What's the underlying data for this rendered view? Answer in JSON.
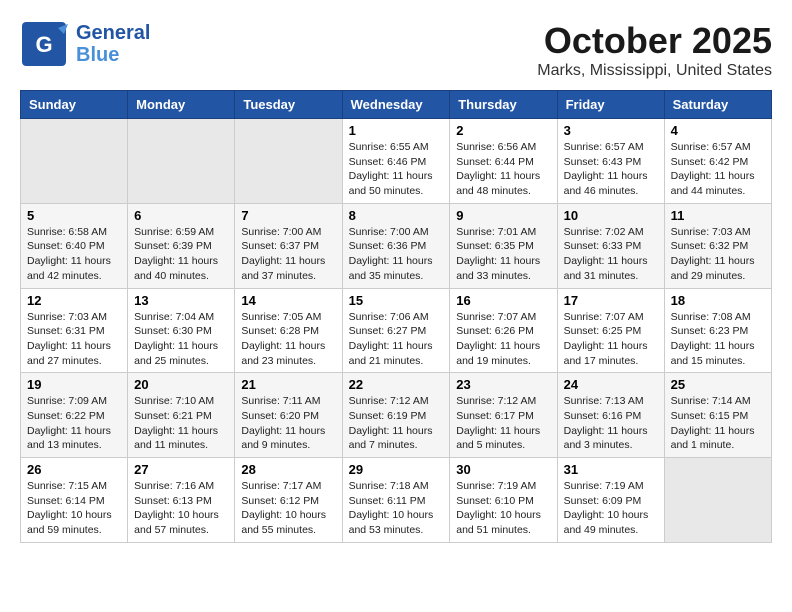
{
  "logo": {
    "general": "General",
    "blue": "Blue",
    "bird_symbol": "🐦"
  },
  "title": "October 2025",
  "location": "Marks, Mississippi, United States",
  "headers": [
    "Sunday",
    "Monday",
    "Tuesday",
    "Wednesday",
    "Thursday",
    "Friday",
    "Saturday"
  ],
  "weeks": [
    [
      {
        "day": "",
        "info": ""
      },
      {
        "day": "",
        "info": ""
      },
      {
        "day": "",
        "info": ""
      },
      {
        "day": "1",
        "info": "Sunrise: 6:55 AM\nSunset: 6:46 PM\nDaylight: 11 hours\nand 50 minutes."
      },
      {
        "day": "2",
        "info": "Sunrise: 6:56 AM\nSunset: 6:44 PM\nDaylight: 11 hours\nand 48 minutes."
      },
      {
        "day": "3",
        "info": "Sunrise: 6:57 AM\nSunset: 6:43 PM\nDaylight: 11 hours\nand 46 minutes."
      },
      {
        "day": "4",
        "info": "Sunrise: 6:57 AM\nSunset: 6:42 PM\nDaylight: 11 hours\nand 44 minutes."
      }
    ],
    [
      {
        "day": "5",
        "info": "Sunrise: 6:58 AM\nSunset: 6:40 PM\nDaylight: 11 hours\nand 42 minutes."
      },
      {
        "day": "6",
        "info": "Sunrise: 6:59 AM\nSunset: 6:39 PM\nDaylight: 11 hours\nand 40 minutes."
      },
      {
        "day": "7",
        "info": "Sunrise: 7:00 AM\nSunset: 6:37 PM\nDaylight: 11 hours\nand 37 minutes."
      },
      {
        "day": "8",
        "info": "Sunrise: 7:00 AM\nSunset: 6:36 PM\nDaylight: 11 hours\nand 35 minutes."
      },
      {
        "day": "9",
        "info": "Sunrise: 7:01 AM\nSunset: 6:35 PM\nDaylight: 11 hours\nand 33 minutes."
      },
      {
        "day": "10",
        "info": "Sunrise: 7:02 AM\nSunset: 6:33 PM\nDaylight: 11 hours\nand 31 minutes."
      },
      {
        "day": "11",
        "info": "Sunrise: 7:03 AM\nSunset: 6:32 PM\nDaylight: 11 hours\nand 29 minutes."
      }
    ],
    [
      {
        "day": "12",
        "info": "Sunrise: 7:03 AM\nSunset: 6:31 PM\nDaylight: 11 hours\nand 27 minutes."
      },
      {
        "day": "13",
        "info": "Sunrise: 7:04 AM\nSunset: 6:30 PM\nDaylight: 11 hours\nand 25 minutes."
      },
      {
        "day": "14",
        "info": "Sunrise: 7:05 AM\nSunset: 6:28 PM\nDaylight: 11 hours\nand 23 minutes."
      },
      {
        "day": "15",
        "info": "Sunrise: 7:06 AM\nSunset: 6:27 PM\nDaylight: 11 hours\nand 21 minutes."
      },
      {
        "day": "16",
        "info": "Sunrise: 7:07 AM\nSunset: 6:26 PM\nDaylight: 11 hours\nand 19 minutes."
      },
      {
        "day": "17",
        "info": "Sunrise: 7:07 AM\nSunset: 6:25 PM\nDaylight: 11 hours\nand 17 minutes."
      },
      {
        "day": "18",
        "info": "Sunrise: 7:08 AM\nSunset: 6:23 PM\nDaylight: 11 hours\nand 15 minutes."
      }
    ],
    [
      {
        "day": "19",
        "info": "Sunrise: 7:09 AM\nSunset: 6:22 PM\nDaylight: 11 hours\nand 13 minutes."
      },
      {
        "day": "20",
        "info": "Sunrise: 7:10 AM\nSunset: 6:21 PM\nDaylight: 11 hours\nand 11 minutes."
      },
      {
        "day": "21",
        "info": "Sunrise: 7:11 AM\nSunset: 6:20 PM\nDaylight: 11 hours\nand 9 minutes."
      },
      {
        "day": "22",
        "info": "Sunrise: 7:12 AM\nSunset: 6:19 PM\nDaylight: 11 hours\nand 7 minutes."
      },
      {
        "day": "23",
        "info": "Sunrise: 7:12 AM\nSunset: 6:17 PM\nDaylight: 11 hours\nand 5 minutes."
      },
      {
        "day": "24",
        "info": "Sunrise: 7:13 AM\nSunset: 6:16 PM\nDaylight: 11 hours\nand 3 minutes."
      },
      {
        "day": "25",
        "info": "Sunrise: 7:14 AM\nSunset: 6:15 PM\nDaylight: 11 hours\nand 1 minute."
      }
    ],
    [
      {
        "day": "26",
        "info": "Sunrise: 7:15 AM\nSunset: 6:14 PM\nDaylight: 10 hours\nand 59 minutes."
      },
      {
        "day": "27",
        "info": "Sunrise: 7:16 AM\nSunset: 6:13 PM\nDaylight: 10 hours\nand 57 minutes."
      },
      {
        "day": "28",
        "info": "Sunrise: 7:17 AM\nSunset: 6:12 PM\nDaylight: 10 hours\nand 55 minutes."
      },
      {
        "day": "29",
        "info": "Sunrise: 7:18 AM\nSunset: 6:11 PM\nDaylight: 10 hours\nand 53 minutes."
      },
      {
        "day": "30",
        "info": "Sunrise: 7:19 AM\nSunset: 6:10 PM\nDaylight: 10 hours\nand 51 minutes."
      },
      {
        "day": "31",
        "info": "Sunrise: 7:19 AM\nSunset: 6:09 PM\nDaylight: 10 hours\nand 49 minutes."
      },
      {
        "day": "",
        "info": ""
      }
    ]
  ]
}
